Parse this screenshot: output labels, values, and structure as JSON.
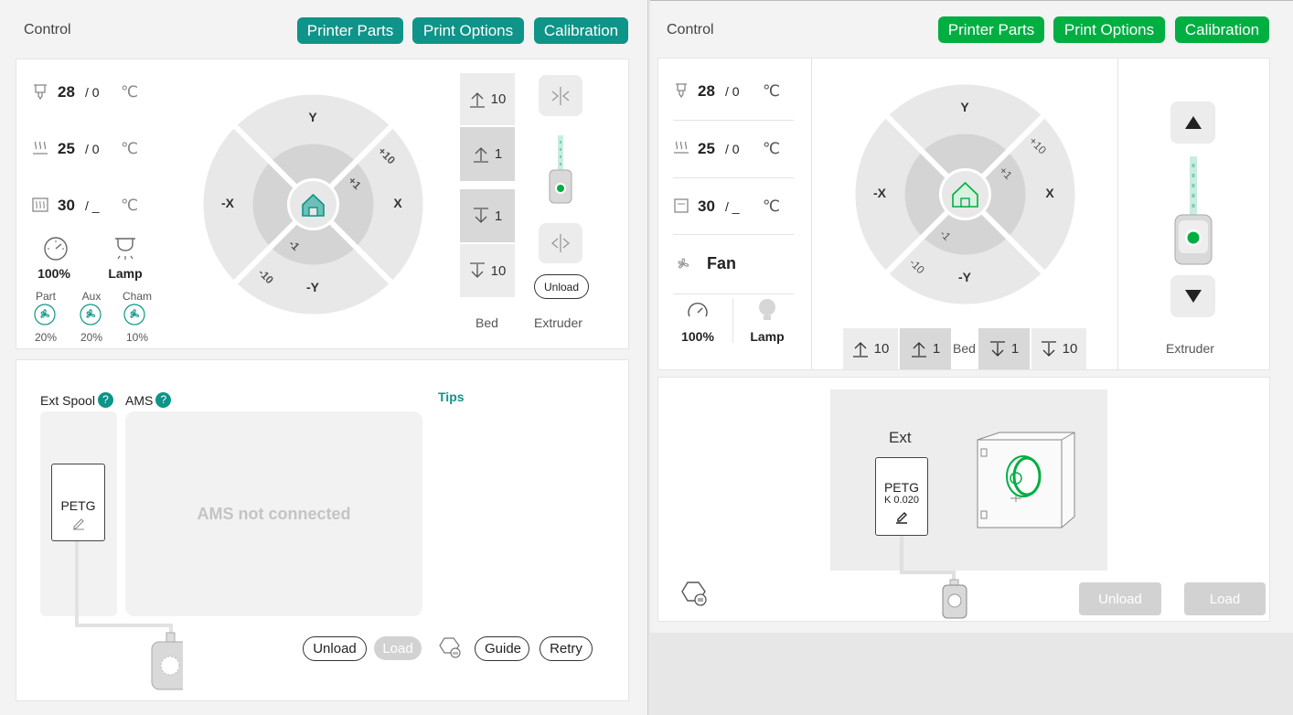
{
  "left": {
    "header": {
      "title": "Control",
      "printer_parts": "Printer Parts",
      "print_options": "Print Options",
      "calibration": "Calibration"
    },
    "temps": [
      {
        "icon": "nozzle-icon",
        "value": "28",
        "target": "/ 0",
        "unit": "℃"
      },
      {
        "icon": "bed-heat-icon",
        "value": "25",
        "target": "/ 0",
        "unit": "℃"
      },
      {
        "icon": "chamber-icon",
        "value": "30",
        "target": "/ _",
        "unit": "℃"
      }
    ],
    "speed": "100%",
    "lamp": "Lamp",
    "fans": [
      {
        "name": "Part",
        "value": "20%"
      },
      {
        "name": "Aux",
        "value": "20%"
      },
      {
        "name": "Cham",
        "value": "10%"
      }
    ],
    "jog": {
      "y": "Y",
      "ny": "-Y",
      "x": "X",
      "nx": "-X",
      "p10": "+10",
      "p1": "+1",
      "m1": "-1",
      "m10": "-10"
    },
    "bed": {
      "up10": "10",
      "up1": "1",
      "down1": "1",
      "down10": "10",
      "label": "Bed"
    },
    "extruder": {
      "unload": "Unload",
      "label": "Extruder"
    },
    "filament": {
      "ext_spool": "Ext Spool",
      "ams": "AMS",
      "tips": "Tips",
      "spool_type": "PETG",
      "ams_status": "AMS not connected",
      "unload": "Unload",
      "load": "Load",
      "guide": "Guide",
      "retry": "Retry"
    }
  },
  "right": {
    "header": {
      "title": "Control",
      "printer_parts": "Printer Parts",
      "print_options": "Print Options",
      "calibration": "Calibration"
    },
    "temps": [
      {
        "icon": "nozzle-icon",
        "value": "28",
        "target": "/ 0",
        "unit": "℃"
      },
      {
        "icon": "bed-heat-icon",
        "value": "25",
        "target": "/ 0",
        "unit": "℃"
      },
      {
        "icon": "chamber-icon",
        "value": "30",
        "target": "/ _",
        "unit": "℃"
      }
    ],
    "fan": "Fan",
    "speed": "100%",
    "lamp": "Lamp",
    "jog": {
      "y": "Y",
      "ny": "-Y",
      "x": "X",
      "nx": "-X",
      "p10": "+10",
      "p1": "+1",
      "m1": "-1",
      "m10": "-10"
    },
    "bed": {
      "up10": "10",
      "up1": "1",
      "label": "Bed",
      "down1": "1",
      "down10": "10"
    },
    "extruder": {
      "label": "Extruder"
    },
    "filament": {
      "ext": "Ext",
      "type": "PETG",
      "k": "K 0.020",
      "unload": "Unload",
      "load": "Load"
    }
  },
  "colors": {
    "teal": "#0e9488",
    "green": "#00ae42"
  }
}
